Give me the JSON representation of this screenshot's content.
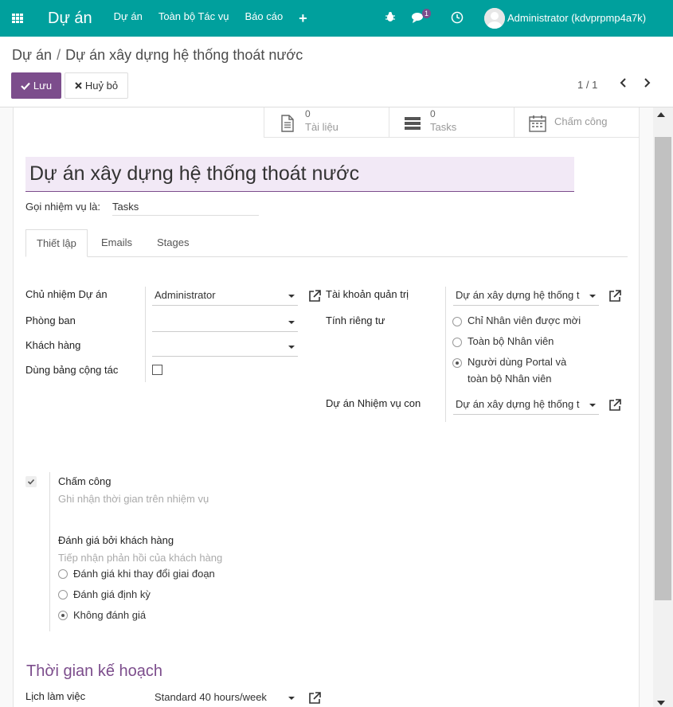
{
  "navbar": {
    "brand": "Dự án",
    "menu": [
      "Dự án",
      "Toàn bộ Tác vụ",
      "Báo cáo"
    ],
    "plus": "+",
    "chat_count": "1",
    "user": "Administrator (kdvprpmp4a7k)",
    "icons": [
      "apps-icon",
      "bug-icon",
      "chat-icon",
      "clock-icon",
      "avatar"
    ]
  },
  "breadcrumb": {
    "parent": "Dự án",
    "separator": "/",
    "current": "Dự án xây dựng hệ thống thoát nước"
  },
  "toolbar": {
    "save": "Lưu",
    "discard": "Huỷ bỏ",
    "pager": "1 / 1"
  },
  "smart_buttons": [
    {
      "count": "0",
      "label": "Tài liệu",
      "icon": "document-icon"
    },
    {
      "count": "0",
      "label": "Tasks",
      "icon": "tasks-icon"
    },
    {
      "count": "",
      "label": "Chấm công",
      "icon": "calendar-icon"
    }
  ],
  "project_name": "Dự án xây dựng hệ thống thoát nước",
  "task_alias": {
    "label": "Gọi nhiệm vụ là:",
    "value": "Tasks"
  },
  "tabs": [
    "Thiết lập",
    "Emails",
    "Stages"
  ],
  "settings": {
    "manager_label": "Chủ nhiệm Dự án",
    "manager_value": "Administrator",
    "department_label": "Phòng ban",
    "department_value": "",
    "customer_label": "Khách hàng",
    "customer_value": "",
    "collab_label": "Dùng bảng cộng tác",
    "analytic_label": "Tài khoản quản trị",
    "analytic_value": "Dự án xây dựng hệ thống t",
    "privacy_label": "Tính riêng tư",
    "privacy_options": [
      "Chỉ Nhân viên được mời",
      "Toàn bộ Nhân viên",
      "Người dùng Portal và",
      "toàn bộ Nhân viên"
    ],
    "privacy_selected": 2,
    "subtask_label": "Dự án Nhiệm vụ con",
    "subtask_value": "Dự án xây dựng hệ thống t"
  },
  "timesheet": {
    "title": "Chấm công",
    "help": "Ghi nhận thời gian trên nhiệm vụ",
    "checked": true
  },
  "rating": {
    "title": "Đánh giá bởi khách hàng",
    "help": "Tiếp nhận phản hồi của khách hàng",
    "options": [
      "Đánh giá khi thay đổi giai đoạn",
      "Đánh giá định kỳ",
      "Không đánh giá"
    ],
    "selected": 2
  },
  "planning": {
    "title": "Thời gian kế hoạch",
    "calendar_label": "Lịch làm việc",
    "calendar_value": "Standard 40 hours/week"
  },
  "colors": {
    "navbar": "#00a09d",
    "primary": "#7c4d8c",
    "title_bg": "#f2e9f6"
  }
}
